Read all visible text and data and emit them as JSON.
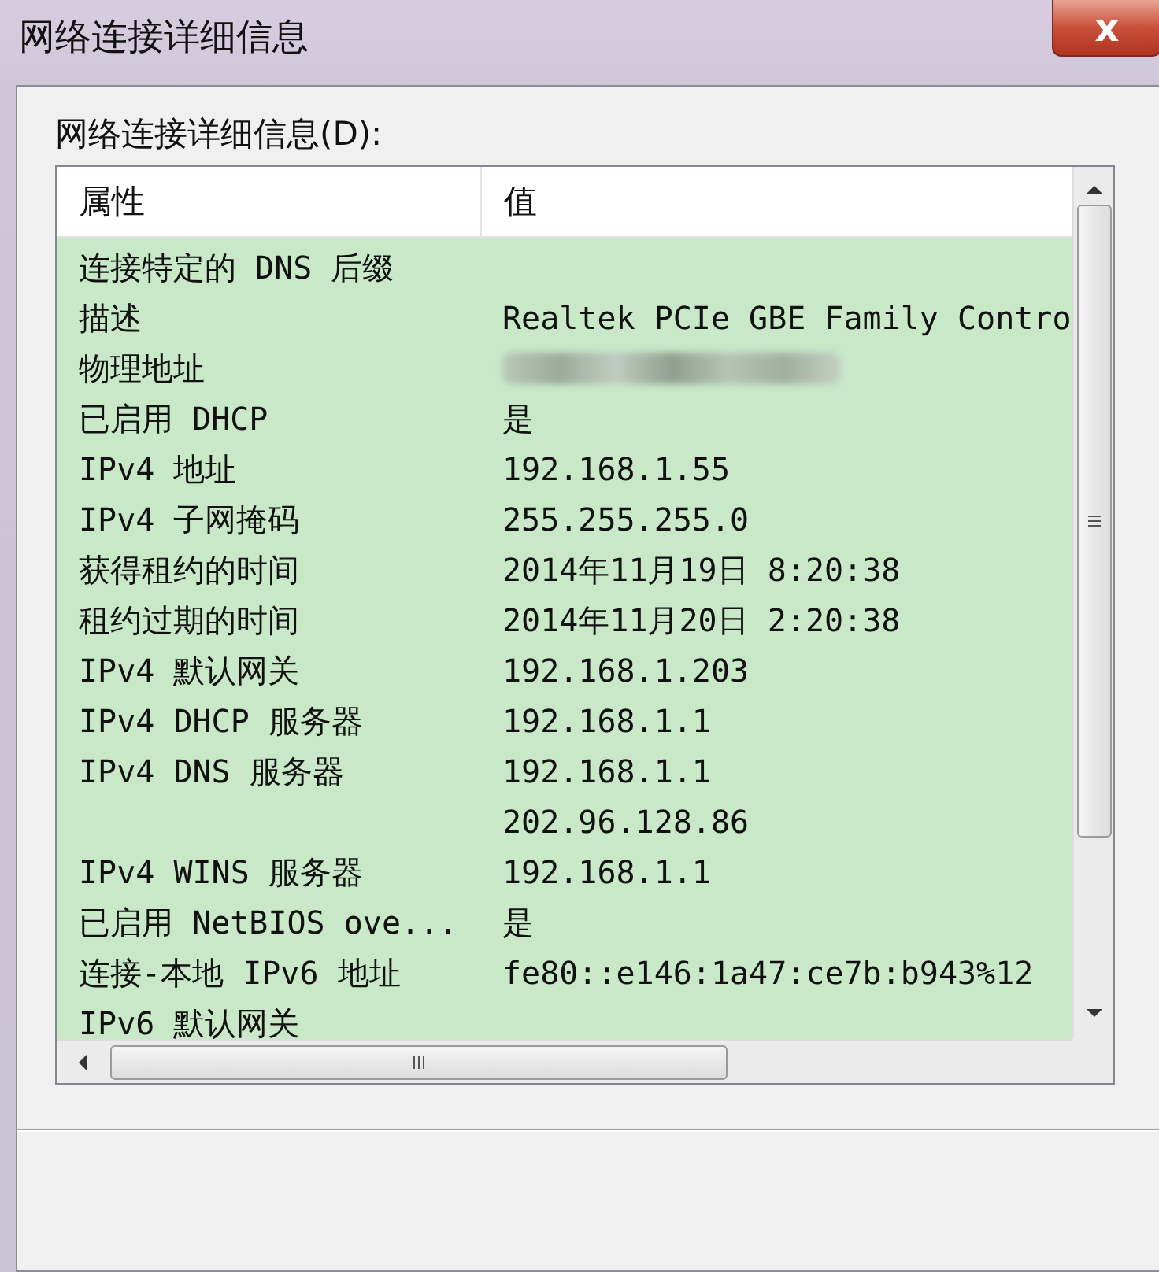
{
  "window": {
    "title": "网络连接详细信息",
    "close": "x"
  },
  "list_label": "网络连接详细信息(D):",
  "table": {
    "columns": [
      "属性",
      "值"
    ],
    "rows": [
      {
        "property": "连接特定的 DNS 后缀",
        "value": ""
      },
      {
        "property": "描述",
        "value": "Realtek PCIe GBE Family Contro"
      },
      {
        "property": "物理地址",
        "kind": "redacted"
      },
      {
        "property": "已启用 DHCP",
        "value": "是"
      },
      {
        "property": "IPv4 地址",
        "value": "192.168.1.55"
      },
      {
        "property": "IPv4 子网掩码",
        "value": "255.255.255.0"
      },
      {
        "property": "获得租约的时间",
        "value": "2014年11月19日 8:20:38"
      },
      {
        "property": "租约过期的时间",
        "value": "2014年11月20日 2:20:38"
      },
      {
        "property": "IPv4 默认网关",
        "value": "192.168.1.203"
      },
      {
        "property": "IPv4 DHCP 服务器",
        "value": "192.168.1.1"
      },
      {
        "property": "IPv4 DNS 服务器",
        "value": "192.168.1.1"
      },
      {
        "property": "",
        "value": "202.96.128.86"
      },
      {
        "property": "IPv4 WINS 服务器",
        "value": "192.168.1.1"
      },
      {
        "property": "已启用 NetBIOS ove...",
        "value": "是"
      },
      {
        "property": "连接-本地 IPv6 地址",
        "value": "fe80::e146:1a47:ce7b:b943%12"
      },
      {
        "property": "IPv6 默认网关",
        "value": ""
      }
    ]
  }
}
